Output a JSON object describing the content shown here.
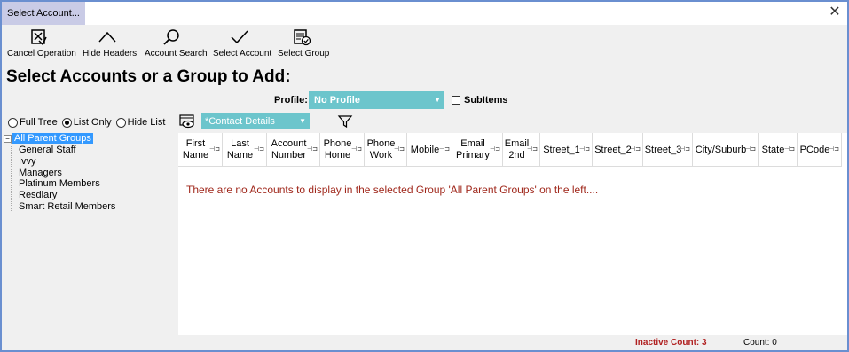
{
  "window": {
    "title": "Select Account..."
  },
  "toolbar": {
    "cancel": "Cancel Operation",
    "hide_headers": "Hide Headers",
    "account_search": "Account Search",
    "select_account": "Select Account",
    "select_group": "Select Group"
  },
  "heading": "Select Accounts or a Group to Add:",
  "profile": {
    "label": "Profile:",
    "value": "No Profile",
    "subitems_label": "SubItems",
    "subitems_checked": false
  },
  "view_options": {
    "full_tree": "Full Tree",
    "list_only": "List Only",
    "hide_list": "Hide List",
    "selected": "List Only"
  },
  "contact_select": {
    "value": "*Contact Details"
  },
  "tree": {
    "root": "All Parent Groups",
    "children": [
      "General Staff",
      "Ivvy",
      "Managers",
      "Platinum Members",
      "Resdiary",
      "Smart Retail Members"
    ]
  },
  "grid": {
    "columns": [
      "First Name",
      "Last Name",
      "Account Number",
      "Phone Home",
      "Phone Work",
      "Mobile",
      "Email Primary",
      "Email 2nd",
      "Street_1",
      "Street_2",
      "Street_3",
      "City/Suburb",
      "State",
      "PCode"
    ],
    "empty_message": "There are no Accounts to display in the selected Group 'All Parent Groups' on the left...."
  },
  "status": {
    "inactive": "Inactive Count: 3",
    "count": "Count: 0"
  },
  "colors": {
    "accent": "#6cc5cc",
    "selection": "#3399ff",
    "error_text": "#a0281c",
    "title_tab": "#c9cbe6"
  }
}
